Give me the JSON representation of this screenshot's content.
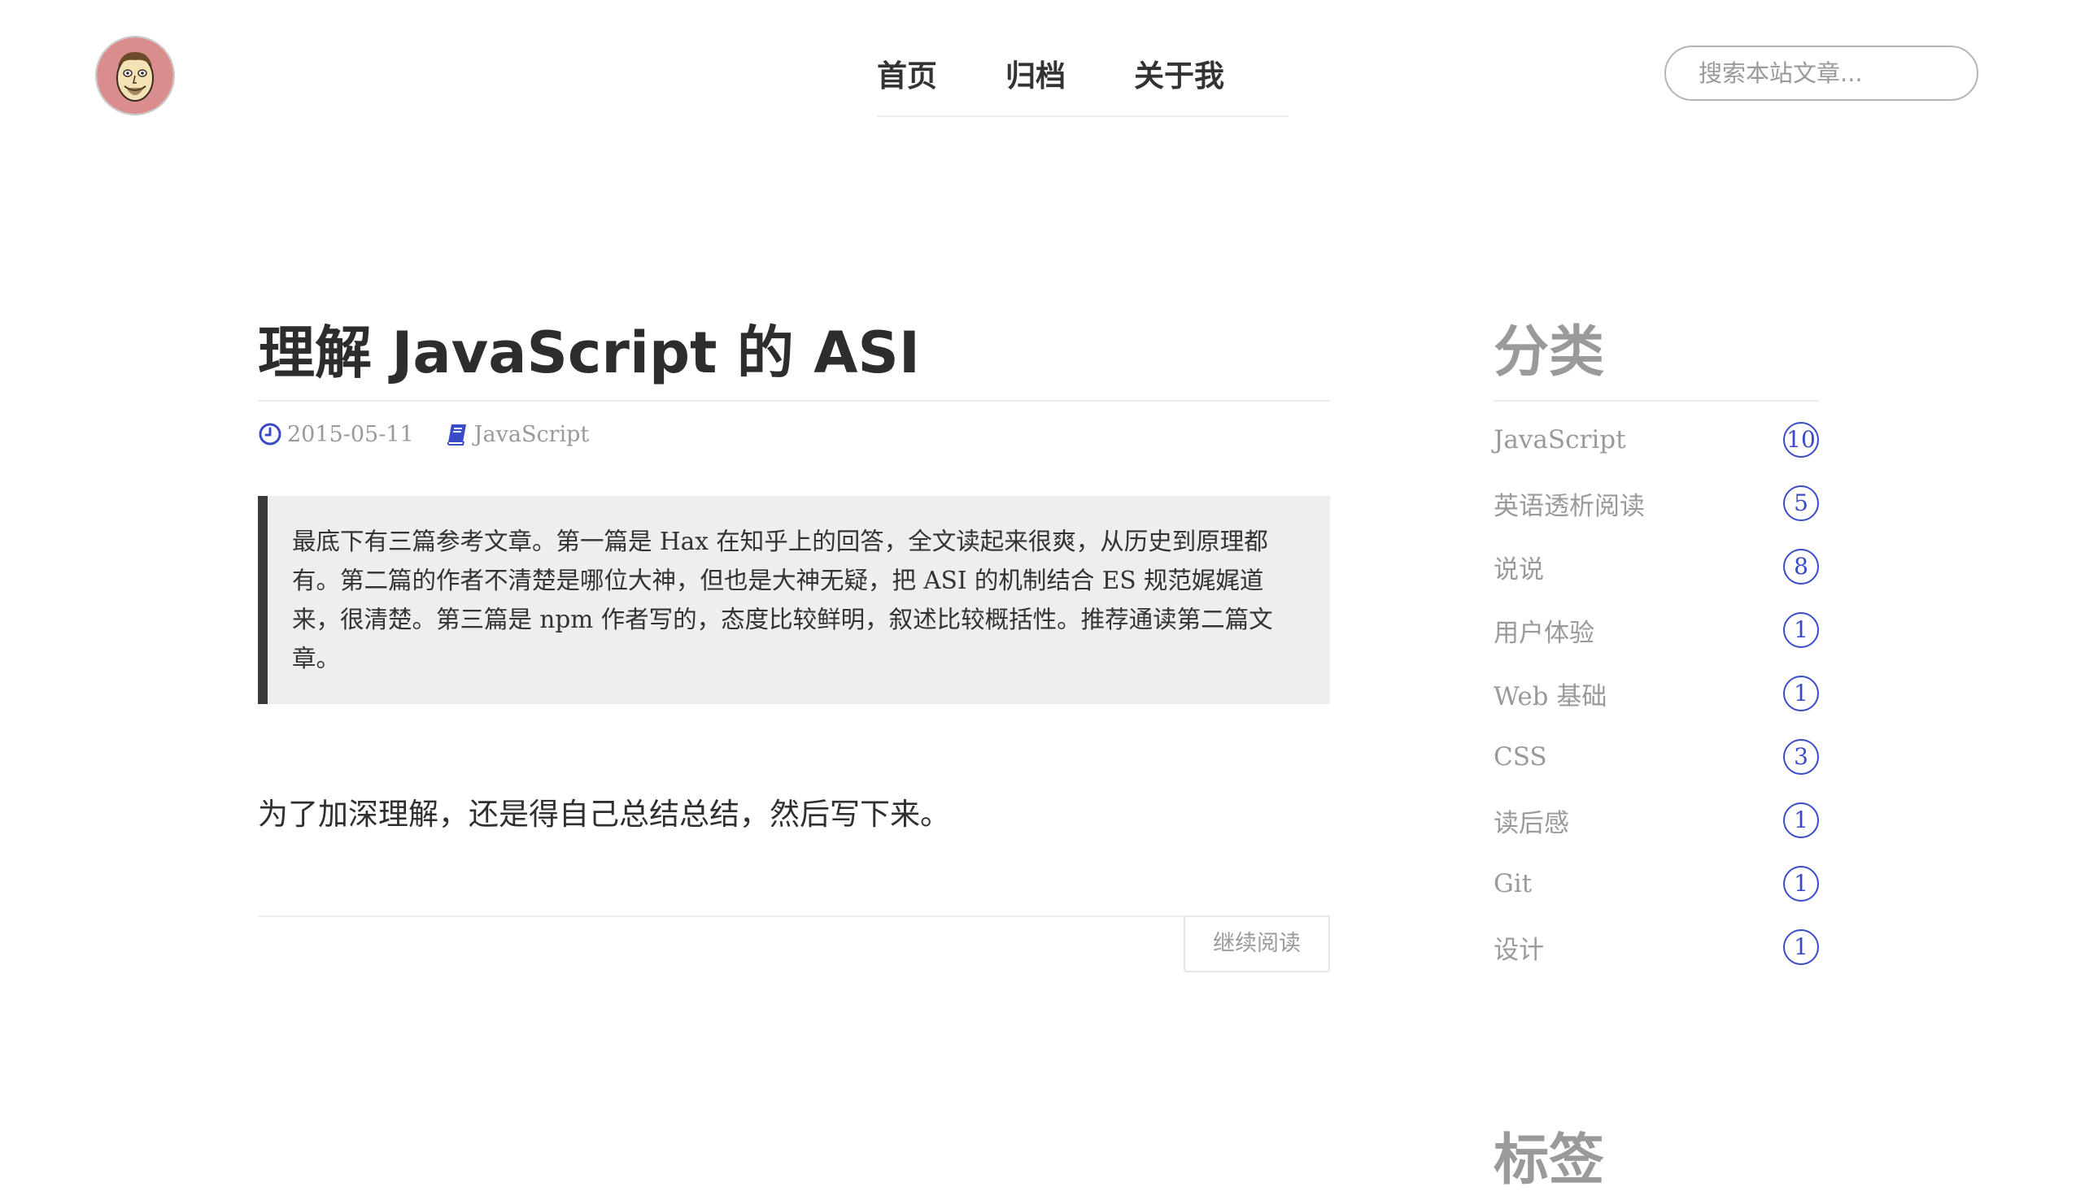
{
  "header": {
    "nav": [
      {
        "label": "首页"
      },
      {
        "label": "归档"
      },
      {
        "label": "关于我"
      }
    ],
    "search_placeholder": "搜索本站文章..."
  },
  "post": {
    "title": "理解 JavaScript 的 ASI",
    "date": "2015-05-11",
    "category": "JavaScript",
    "quote": "最底下有三篇参考文章。第一篇是 Hax 在知乎上的回答，全文读起来很爽，从历史到原理都有。第二篇的作者不清楚是哪位大神，但也是大神无疑，把 ASI 的机制结合 ES 规范娓娓道来，很清楚。第三篇是 npm 作者写的，态度比较鲜明，叙述比较概括性。推荐通读第二篇文章。",
    "body": "为了加深理解，还是得自己总结总结，然后写下来。",
    "read_more": "继续阅读"
  },
  "sidebar": {
    "categories_title": "分类",
    "categories": [
      {
        "name": "JavaScript",
        "count": "10"
      },
      {
        "name": "英语透析阅读",
        "count": "5"
      },
      {
        "name": "说说",
        "count": "8"
      },
      {
        "name": "用户体验",
        "count": "1"
      },
      {
        "name": "Web 基础",
        "count": "1"
      },
      {
        "name": "CSS",
        "count": "3"
      },
      {
        "name": "读后感",
        "count": "1"
      },
      {
        "name": "Git",
        "count": "1"
      },
      {
        "name": "设计",
        "count": "1"
      }
    ],
    "tags_title": "标签"
  },
  "colors": {
    "accent": "#3b4bc8",
    "muted_text": "#9a9a9a",
    "quote_bg": "#eeeeee",
    "quote_bar": "#3a3a3a"
  },
  "icons": {
    "date": "clock-icon",
    "category": "book-icon",
    "avatar": "cartoon-face-avatar"
  }
}
